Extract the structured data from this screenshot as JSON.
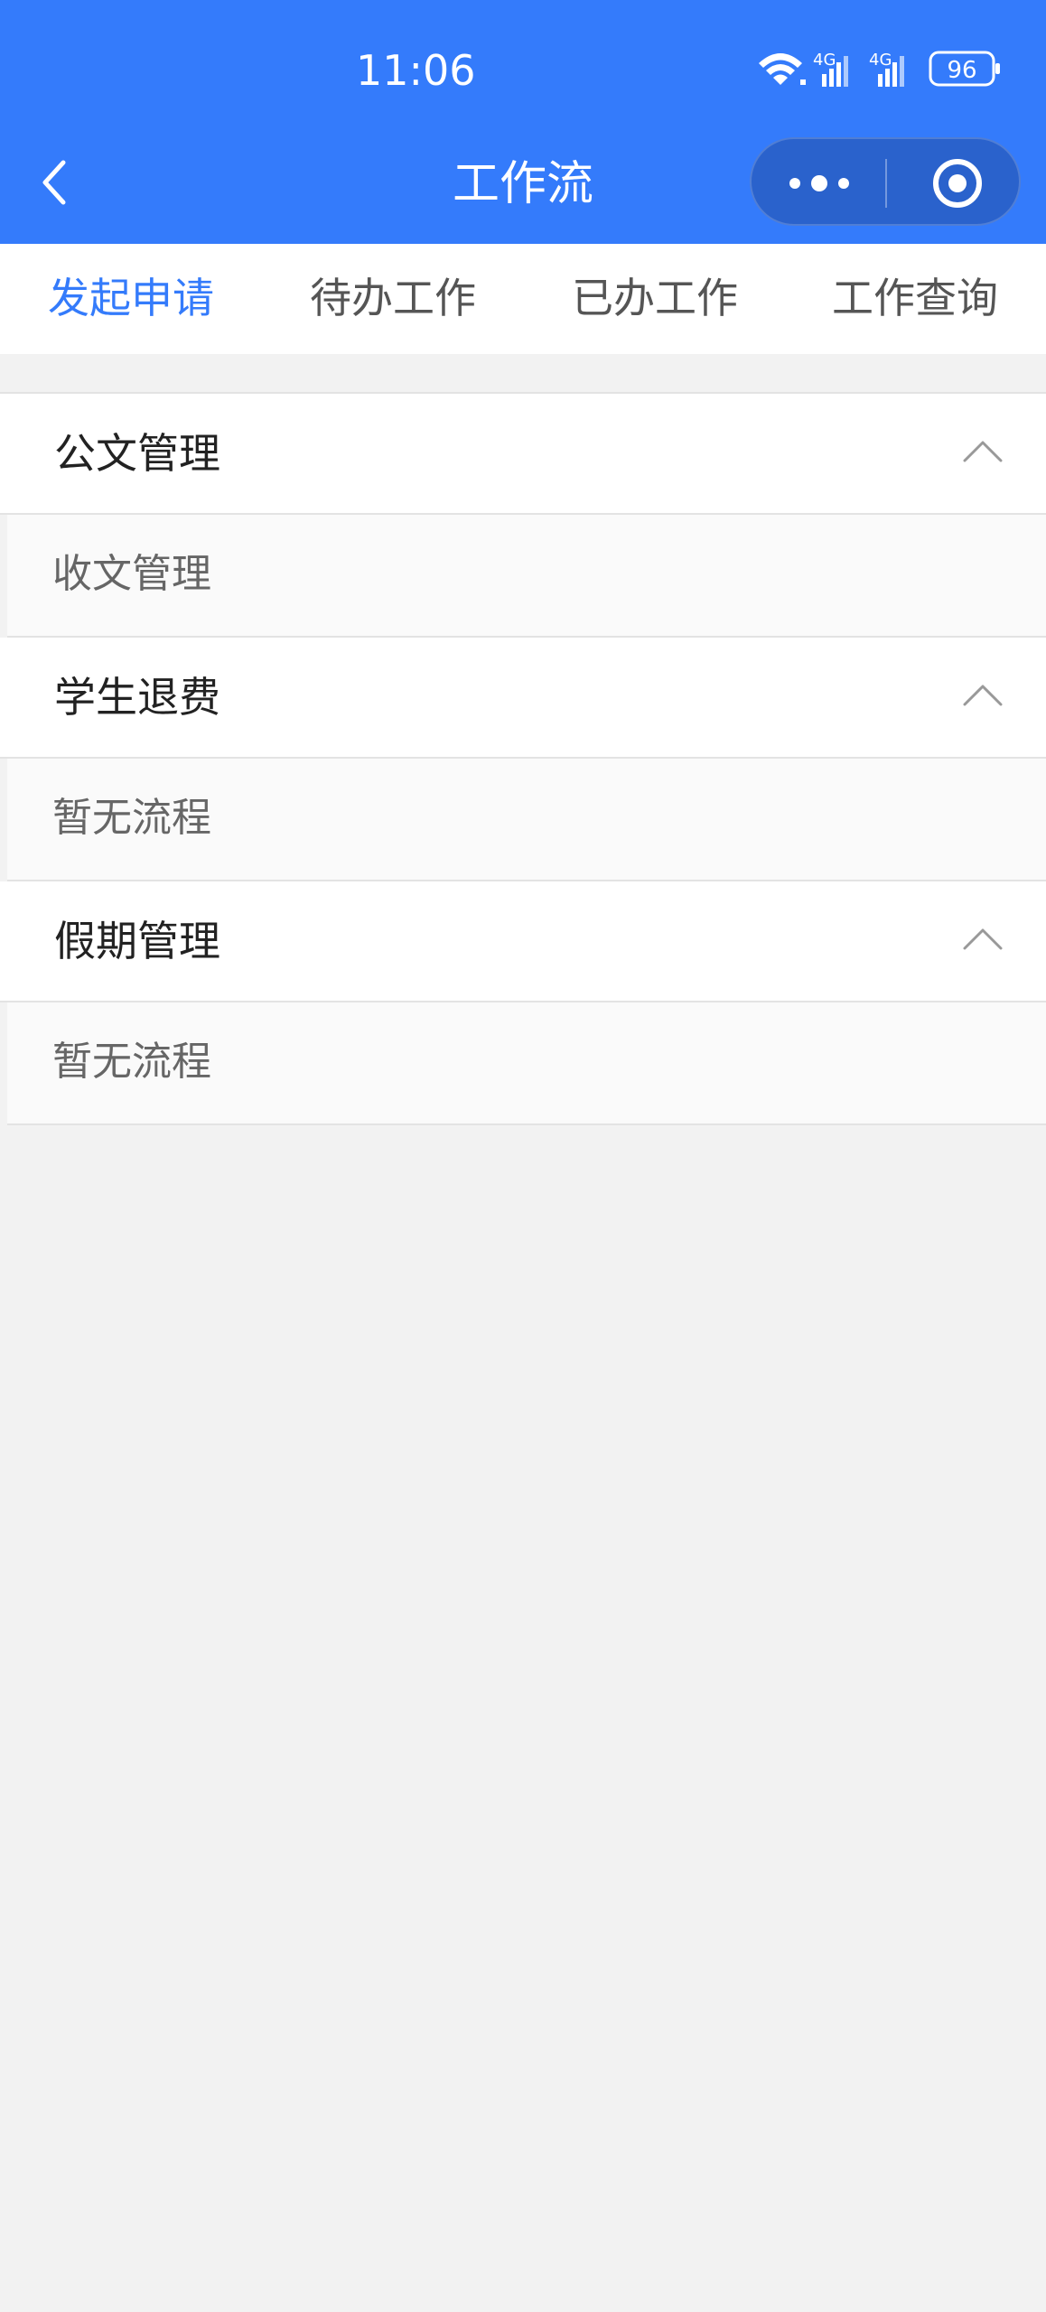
{
  "status_bar": {
    "time": "11:06",
    "battery": "96",
    "signal_1": "4G",
    "signal_2": "4G",
    "icons": [
      "wifi-icon",
      "signal-icon",
      "signal-icon",
      "battery-icon"
    ]
  },
  "nav": {
    "title": "工作流",
    "icons": [
      "back-arrow-icon",
      "more-dots-icon",
      "close-target-icon"
    ]
  },
  "tabs": [
    {
      "label": "发起申请",
      "active": true
    },
    {
      "label": "待办工作",
      "active": false
    },
    {
      "label": "已办工作",
      "active": false
    },
    {
      "label": "工作查询",
      "active": false
    }
  ],
  "groups": [
    {
      "title": "公文管理",
      "items": [
        "收文管理"
      ]
    },
    {
      "title": "学生退费",
      "items": [
        "暂无流程"
      ]
    },
    {
      "title": "假期管理",
      "items": [
        "暂无流程"
      ]
    }
  ],
  "colors": {
    "brand_blue": "#347bfb",
    "active_tab": "#347bfb",
    "background": "#f2f2f2"
  }
}
